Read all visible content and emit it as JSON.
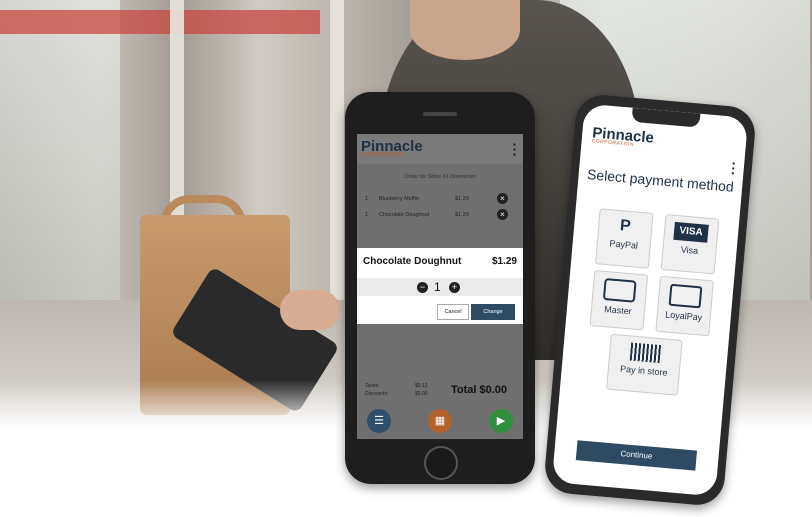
{
  "order_screen": {
    "logo_text": "Pinnacle",
    "logo_sub": "CORPORATION",
    "menu_icon": "vertical-dots-icon",
    "order_for": "Order for Store #1 Downtown",
    "items": [
      {
        "qty": "1",
        "name": "Blueberry Muffin",
        "price": "$1.29"
      },
      {
        "qty": "1",
        "name": "Chocolate Doughnut",
        "price": "$1.29"
      }
    ],
    "modal": {
      "title": "Chocolate Doughnut",
      "price": "$1.29",
      "quantity": "1",
      "cancel_label": "Cancel",
      "change_label": "Change"
    },
    "taxes_label": "Taxes:",
    "taxes_value": "$0.12",
    "discounts_label": "Discounts:",
    "discounts_value": "$0.00",
    "total": "Total $0.00",
    "nav_buttons": [
      "menu-icon",
      "grid-icon",
      "play-icon"
    ]
  },
  "payment_screen": {
    "logo_text": "Pinnacle",
    "logo_sub": "CORPORATION",
    "title": "Select payment method",
    "methods": [
      {
        "label": "PayPal",
        "icon": "paypal-icon"
      },
      {
        "label": "Visa",
        "icon": "visa-icon"
      },
      {
        "label": "Master",
        "icon": "mastercard-icon"
      },
      {
        "label": "LoyalPay",
        "icon": "card-icon"
      },
      {
        "label": "Pay in store",
        "icon": "barcode-icon"
      }
    ],
    "continue_label": "Continue"
  },
  "colors": {
    "brand_navy": "#2f4a63",
    "accent_orange": "#b3622e",
    "accent_green": "#2f8f3c"
  }
}
